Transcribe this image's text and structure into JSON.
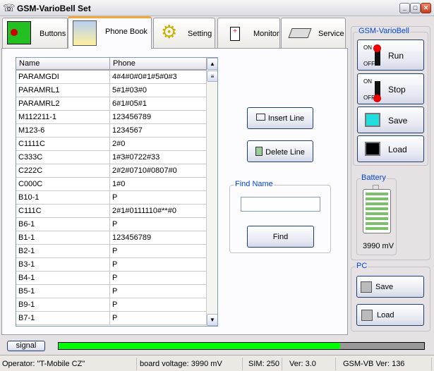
{
  "window": {
    "title": "GSM-VarioBell Set"
  },
  "tabs": [
    {
      "label": "Buttons",
      "icon": "hand-pointer-icon"
    },
    {
      "label": "Phone Book",
      "icon": "phonebook-icon",
      "selected": true
    },
    {
      "label": "Setting",
      "icon": "gears-icon"
    },
    {
      "label": "Monitor",
      "icon": "monitor-device-icon"
    },
    {
      "label": "Service",
      "icon": "chip-icon"
    }
  ],
  "phonebook": {
    "columns": [
      "Name",
      "Phone"
    ],
    "rows": [
      [
        "PARAMGDI",
        "4#4#0#0#1#5#0#3"
      ],
      [
        "PARAMRL1",
        "5#1#03#0"
      ],
      [
        "PARAMRL2",
        "6#1#05#1"
      ],
      [
        "M112211-1",
        "123456789"
      ],
      [
        "M123-6",
        "1234567"
      ],
      [
        "C1111C",
        "2#0"
      ],
      [
        "C333C",
        "1#3#0722#33"
      ],
      [
        "C222C",
        "2#2#0710#0807#0"
      ],
      [
        "C000C",
        "1#0"
      ],
      [
        "B10-1",
        "P"
      ],
      [
        "C111C",
        "2#1#0111110#**#0"
      ],
      [
        "B6-1",
        "P"
      ],
      [
        "B1-1",
        "123456789"
      ],
      [
        "B2-1",
        "P"
      ],
      [
        "B3-1",
        "P"
      ],
      [
        "B4-1",
        "P"
      ],
      [
        "B5-1",
        "P"
      ],
      [
        "B9-1",
        "P"
      ],
      [
        "B7-1",
        "P"
      ]
    ],
    "insert_label": "Insert Line",
    "delete_label": "Delete Line",
    "find_group": "Find Name",
    "find_value": "",
    "find_label": "Find"
  },
  "device": {
    "group": "GSM-VarioBell",
    "on": "ON",
    "off": "OFF",
    "run": "Run",
    "stop": "Stop",
    "save": "Save",
    "load": "Load"
  },
  "battery": {
    "group": "Battery",
    "voltage": "3990 mV",
    "level_fraction": 1.0
  },
  "pc": {
    "group": "PC",
    "save": "Save",
    "load": "Load"
  },
  "signal": {
    "label": "signal",
    "level_fraction": 0.77,
    "fill_color": "#00ff00"
  },
  "status": {
    "operator": "Operator: \"T-Mobile CZ\"",
    "voltage": "board voltage: 3990 mV",
    "sim": "SIM: 250",
    "ver": "Ver: 3.0",
    "gsmvb_ver": "GSM-VB Ver: 136"
  }
}
